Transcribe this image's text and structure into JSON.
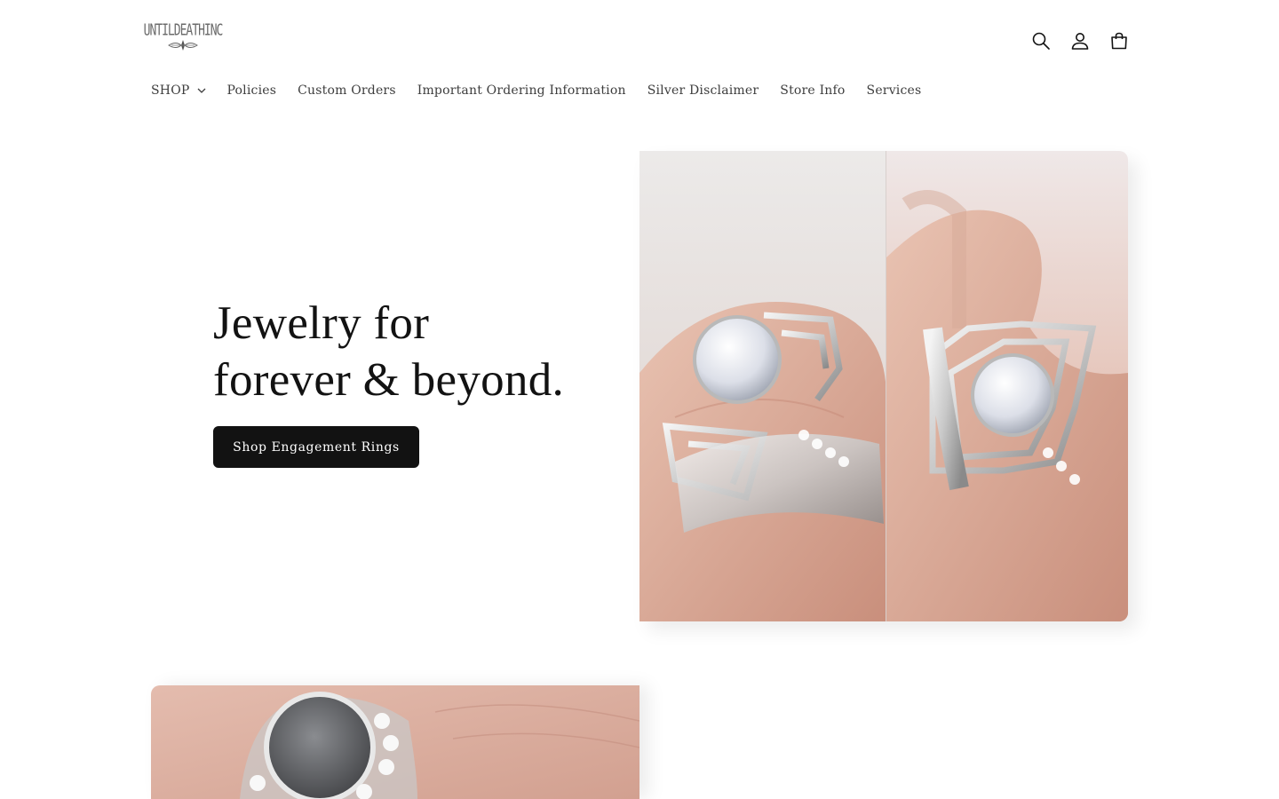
{
  "brand": {
    "logo_text": "UNTILDEATHINC",
    "logo_icon": "flourish-icon"
  },
  "header": {
    "icons": [
      "search-icon",
      "account-icon",
      "cart-icon"
    ]
  },
  "nav": {
    "items": [
      {
        "label": "SHOP",
        "has_dropdown": true
      },
      {
        "label": "Policies"
      },
      {
        "label": "Custom Orders"
      },
      {
        "label": "Important Ordering Information"
      },
      {
        "label": "Silver Disclaimer"
      },
      {
        "label": "Store Info"
      },
      {
        "label": "Services"
      }
    ]
  },
  "hero": {
    "title_line1": "Jewelry for",
    "title_line2": "forever & beyond.",
    "cta_label": "Shop Engagement Rings",
    "image_subject": "spider-web engagement rings on finger"
  },
  "section2": {
    "image_subject": "grey diamond ring with halo on finger"
  },
  "colors": {
    "text": "#121212",
    "nav_text": "#3d3d3d",
    "button_bg": "#121212",
    "button_text": "#ffffff",
    "background": "#ffffff"
  }
}
